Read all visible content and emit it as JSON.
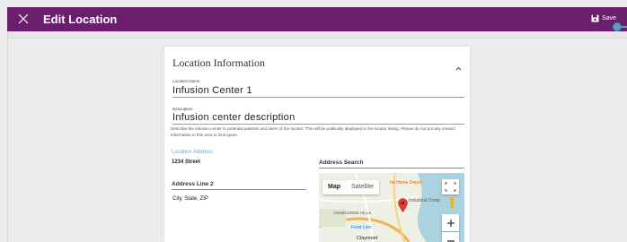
{
  "header": {
    "title": "Edit Location",
    "save_label": "Save"
  },
  "card": {
    "title": "Location Information",
    "location_name": {
      "label": "Location Name",
      "value": "Infusion Center 1"
    },
    "description": {
      "label": "Description",
      "value": "Infusion center description",
      "help": "Describe the infusion center to potential patients and users of the locator. This will be publically displayed in the locator listing. Please do not put any contact information in this area to limit spam."
    },
    "address": {
      "label": "Location Address",
      "line1": "1234 Street",
      "line2_label": "Address Line 2",
      "city_state_zip": "City, State, ZIP"
    },
    "address_search": {
      "label": "Address Search",
      "map_tab": "Map",
      "satellite_tab": "Satellite",
      "labels": [
        "he Home Depot",
        "Ashbourne Hills",
        "Food Lion",
        "Claymont",
        "Industrial Comp"
      ]
    }
  },
  "colors": {
    "header": "#6b1d6e",
    "accent": "#6aa8d4"
  },
  "icons": {
    "close": "close-icon",
    "save": "floppy-disk-icon",
    "collapse": "chevron-up-icon",
    "pin": "map-pin-icon",
    "pegman": "pegman-icon"
  }
}
